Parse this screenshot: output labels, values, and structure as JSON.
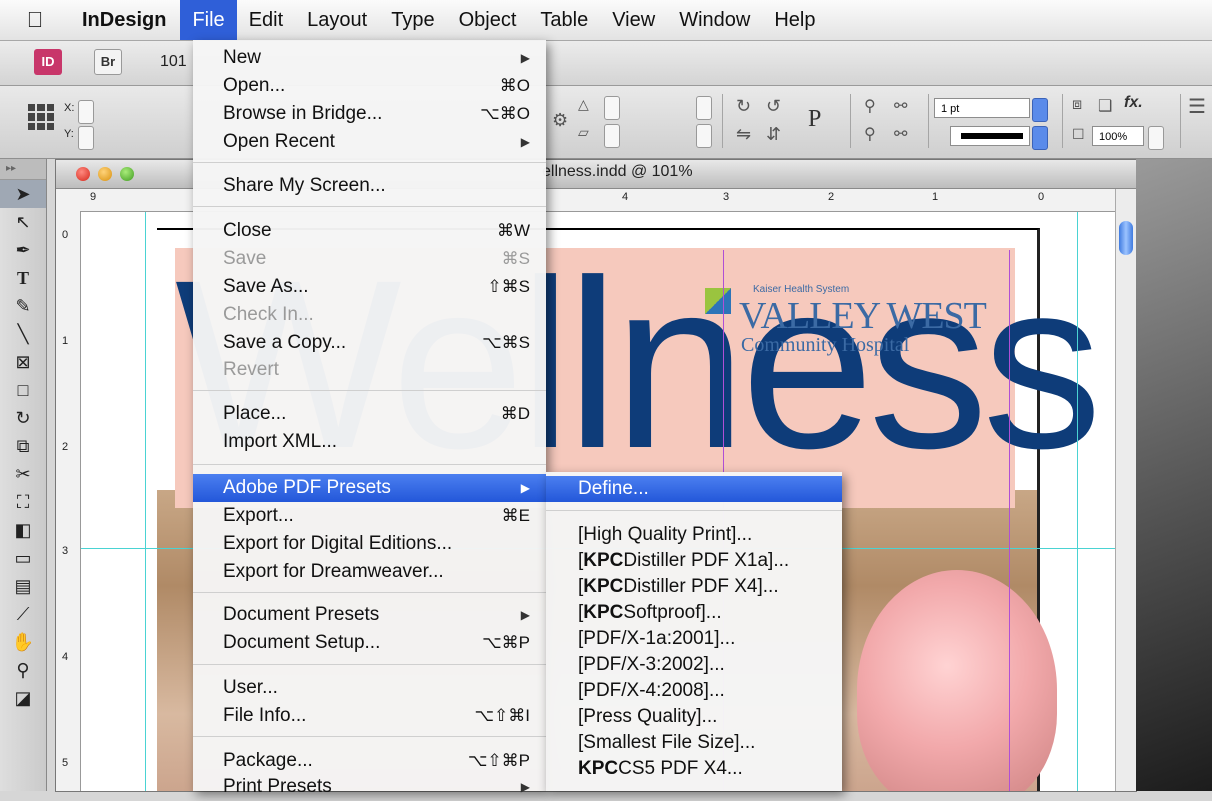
{
  "menubar": {
    "app": "InDesign",
    "items": [
      "File",
      "Edit",
      "Layout",
      "Type",
      "Object",
      "Table",
      "View",
      "Window",
      "Help"
    ]
  },
  "appbar": {
    "id_badge": "ID",
    "bridge_badge": "Br",
    "zoom_fragment": "101"
  },
  "control": {
    "x_label": "X:",
    "y_label": "Y:",
    "stroke_weight": "1 pt",
    "opacity": "100%",
    "fx": "fx."
  },
  "document": {
    "title_fragment": "ellness.indd @ 101%",
    "ruler_h": [
      "9",
      "4",
      "3",
      "2",
      "1",
      "0"
    ],
    "ruler_v": [
      "0",
      "1",
      "2",
      "3",
      "4",
      "5"
    ],
    "headline": "Wellness",
    "logo_small": "Kaiser Health System",
    "logo_name": "VALLEY WEST",
    "logo_sub": "Community Hospital"
  },
  "file_menu": {
    "new": "New",
    "open": "Open...",
    "open_sc": "⌘O",
    "browse": "Browse in Bridge...",
    "browse_sc": "⌥⌘O",
    "open_recent": "Open Recent",
    "share": "Share My Screen...",
    "close": "Close",
    "close_sc": "⌘W",
    "save": "Save",
    "save_sc": "⌘S",
    "save_as": "Save As...",
    "save_as_sc": "⇧⌘S",
    "check_in": "Check In...",
    "save_copy": "Save a Copy...",
    "save_copy_sc": "⌥⌘S",
    "revert": "Revert",
    "place": "Place...",
    "place_sc": "⌘D",
    "import_xml": "Import XML...",
    "pdf_presets": "Adobe PDF Presets",
    "export": "Export...",
    "export_sc": "⌘E",
    "export_digital": "Export for Digital Editions...",
    "export_dw": "Export for Dreamweaver...",
    "doc_presets": "Document Presets",
    "doc_setup": "Document Setup...",
    "doc_setup_sc": "⌥⌘P",
    "user": "User...",
    "file_info": "File Info...",
    "file_info_sc": "⌥⇧⌘I",
    "package": "Package...",
    "package_sc": "⌥⇧⌘P",
    "print_presets": "Print Presets"
  },
  "pdf_submenu": {
    "define": "Define...",
    "high_quality": "[High Quality Print]...",
    "kpc_prefix": "KPC",
    "kpc_x1a": "Distiller PDF X1a]...",
    "kpc_x4": "Distiller PDF X4]...",
    "kpc_soft": "Softproof]...",
    "pdfx1a": "[PDF/X-1a:2001]...",
    "pdfx3": "[PDF/X-3:2002]...",
    "pdfx4": "[PDF/X-4:2008]...",
    "press": "[Press Quality]...",
    "smallest": "[Smallest File Size]...",
    "kpc_cs5": "CS5 PDF X4..."
  }
}
